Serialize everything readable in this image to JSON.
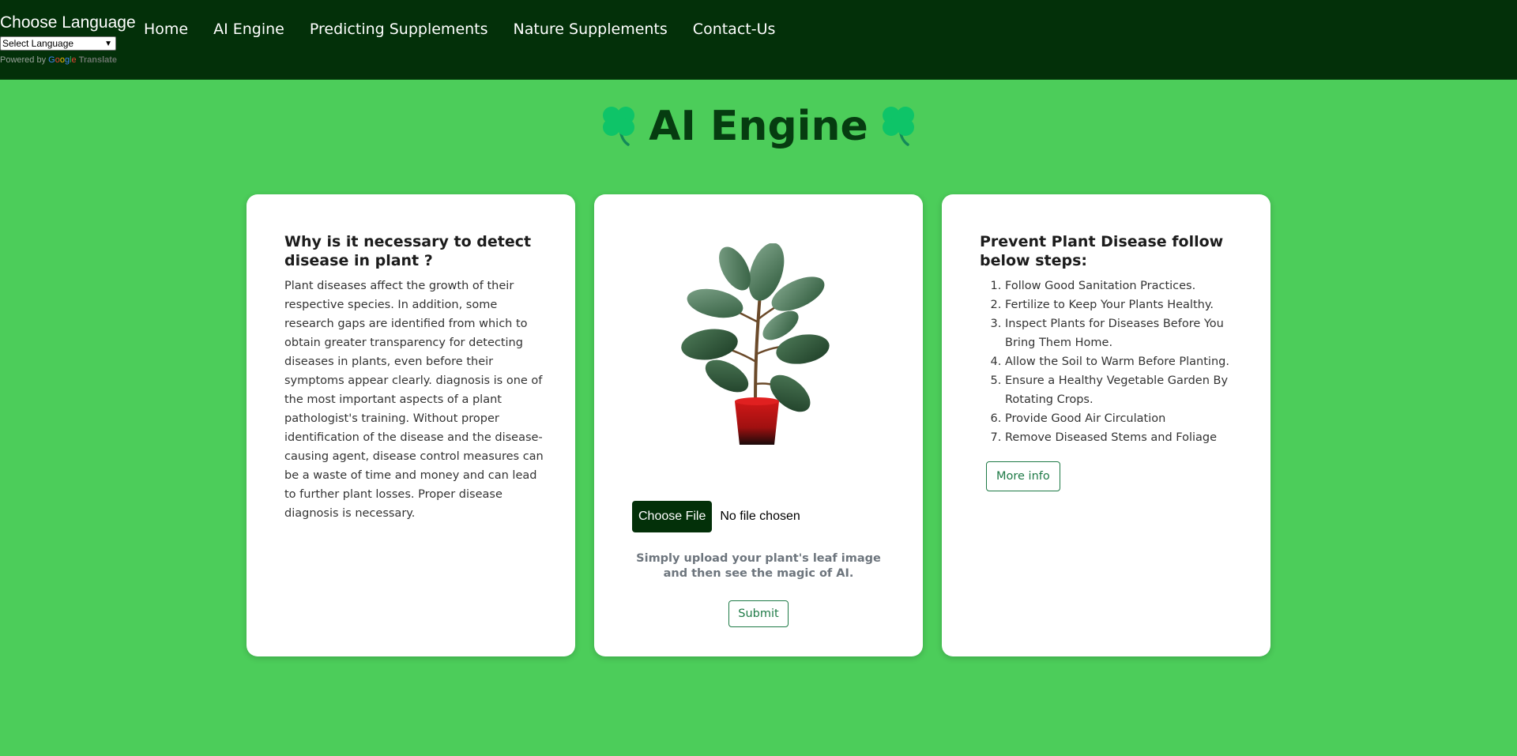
{
  "header": {
    "language": {
      "title": "Choose Language",
      "select_value": "Select Language",
      "powered_prefix": "Powered by",
      "google": [
        "G",
        "o",
        "o",
        "g",
        "l",
        "e"
      ],
      "translate": "Translate"
    },
    "nav": [
      {
        "label": "Home"
      },
      {
        "label": "AI Engine"
      },
      {
        "label": "Predicting Supplements"
      },
      {
        "label": "Nature Supplements"
      },
      {
        "label": "Contact-Us"
      }
    ]
  },
  "page": {
    "title": "AI Engine",
    "icon": "four-leaf-clover-icon",
    "accent_color": "#4ccd5a",
    "header_color": "#033009"
  },
  "cards": {
    "why": {
      "heading": "Why is it necessary to detect disease in plant ?",
      "body": "Plant diseases affect the growth of their respective species. In addition, some research gaps are identified from which to obtain greater transparency for detecting diseases in plants, even before their symptoms appear clearly. diagnosis is one of the most important aspects of a plant pathologist's training. Without proper identification of the disease and the disease-causing agent, disease control measures can be a waste of time and money and can lead to further plant losses. Proper disease diagnosis is necessary."
    },
    "upload": {
      "image": "potted-plant-image",
      "choose_file_label": "Choose File",
      "file_status": "No file chosen",
      "hint": "Simply upload your plant's leaf image and then see the magic of AI.",
      "submit_label": "Submit"
    },
    "prevent": {
      "heading": "Prevent Plant Disease follow below steps:",
      "steps": [
        "Follow Good Sanitation Practices.",
        "Fertilize to Keep Your Plants Healthy.",
        "Inspect Plants for Diseases Before You Bring Them Home.",
        "Allow the Soil to Warm Before Planting.",
        "Ensure a Healthy Vegetable Garden By Rotating Crops.",
        "Provide Good Air Circulation",
        "Remove Diseased Stems and Foliage"
      ],
      "more_info_label": "More info"
    }
  }
}
